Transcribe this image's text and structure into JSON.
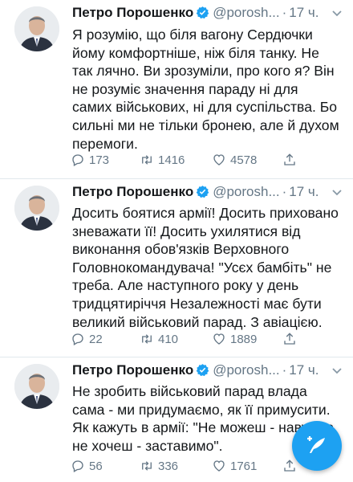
{
  "tweets": [
    {
      "author_name": "Петро Порошенко",
      "handle": "@porosh...",
      "separator": "·",
      "time": "17 ч.",
      "text": "Я розумію, що біля вагону Сердючки\nйому комфортніше, ніж біля танку. Не\nтак лячно. Ви зрозуміли, про кого я?  Він\nне розуміє значення параду ні для\nсамих військових, ні для суспільства. Бо\nсильні ми не тільки бронею, але й духом\nперемоги.",
      "replies": "173",
      "retweets": "1416",
      "likes": "4578"
    },
    {
      "author_name": "Петро Порошенко",
      "handle": "@porosh...",
      "separator": "·",
      "time": "17 ч.",
      "text": "Досить боятися армії! Досить приховано\nзневажати її! Досить ухилятися від\nвиконання обов'язків Верховного\nГоловнокомандувача! \"Усєх бамбіть\" не\nтреба. Але наступного року у день\nтридцятиріччя Незалежності має бути\nвеликий військовий парад. З авіацією.",
      "replies": "22",
      "retweets": "410",
      "likes": "1889"
    },
    {
      "author_name": "Петро Порошенко",
      "handle": "@porosh...",
      "separator": "·",
      "time": "17 ч.",
      "text": "Не зробить військовий парад влада\nсама - ми придумаємо, як її примусити.\nЯк кажуть в армії: \"Не можеш - навчимо,\nне хочеш - заставимо\".",
      "replies": "56",
      "retweets": "336",
      "likes": "1761"
    }
  ],
  "icons": {
    "verified": "verified-badge-icon",
    "more": "chevron-down-icon",
    "reply": "reply-icon",
    "retweet": "retweet-icon",
    "like": "heart-icon",
    "share": "share-icon",
    "compose": "compose-tweet-icon"
  },
  "colors": {
    "accent": "#1da1f2",
    "text": "#14171a",
    "muted": "#657786",
    "divider": "#e1e8ed"
  }
}
